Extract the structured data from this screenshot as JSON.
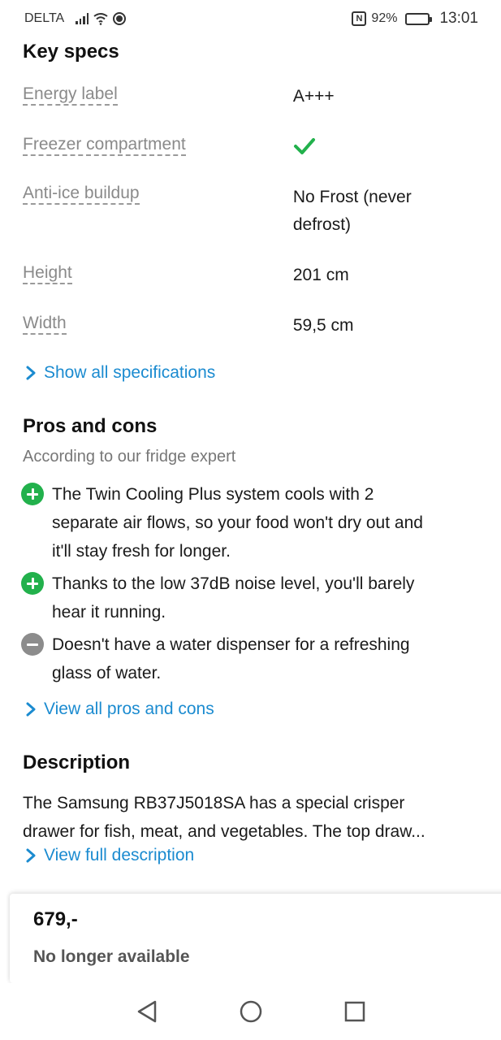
{
  "status_bar": {
    "carrier": "DELTA",
    "battery": "92%",
    "battery_level": 0.92,
    "time": "13:01"
  },
  "key_specs": {
    "title": "Key specs",
    "rows": [
      {
        "label": "Energy label",
        "value": "A+++"
      },
      {
        "label": "Freezer compartment",
        "value": "",
        "icon": "check-icon"
      },
      {
        "label": "Anti-ice buildup",
        "value_line1": "No Frost (never",
        "value_line2": "defrost)"
      },
      {
        "label": "Height",
        "value": "201 cm"
      },
      {
        "label": "Width",
        "value": "59,5 cm"
      }
    ],
    "show_all_link": "Show all specifications"
  },
  "pros_cons": {
    "title": "Pros and cons",
    "subtitle": "According to our fridge expert",
    "items": [
      {
        "type": "pro",
        "line1": "The Twin Cooling Plus system cools with 2",
        "line2": "separate air flows, so your food won't dry out and",
        "line3": "it'll stay fresh for longer."
      },
      {
        "type": "pro",
        "line1": "Thanks to the low 37dB noise level, you'll barely",
        "line2": "hear it running."
      },
      {
        "type": "con",
        "line1": "Doesn't have a water dispenser for a refreshing",
        "line2": "glass of water."
      }
    ],
    "view_all_link": "View all pros and cons"
  },
  "description": {
    "title": "Description",
    "line1": "The Samsung RB37J5018SA has a special crisper",
    "line2": "drawer for fish, meat, and vegetables. The top draw...",
    "view_full_link": "View full description"
  },
  "price_card": {
    "price": "679,-",
    "availability": "No longer available"
  },
  "colors": {
    "link": "#1b8bd0",
    "pro": "#22b14c",
    "con": "#8c8c8c",
    "check": "#22b14c"
  }
}
